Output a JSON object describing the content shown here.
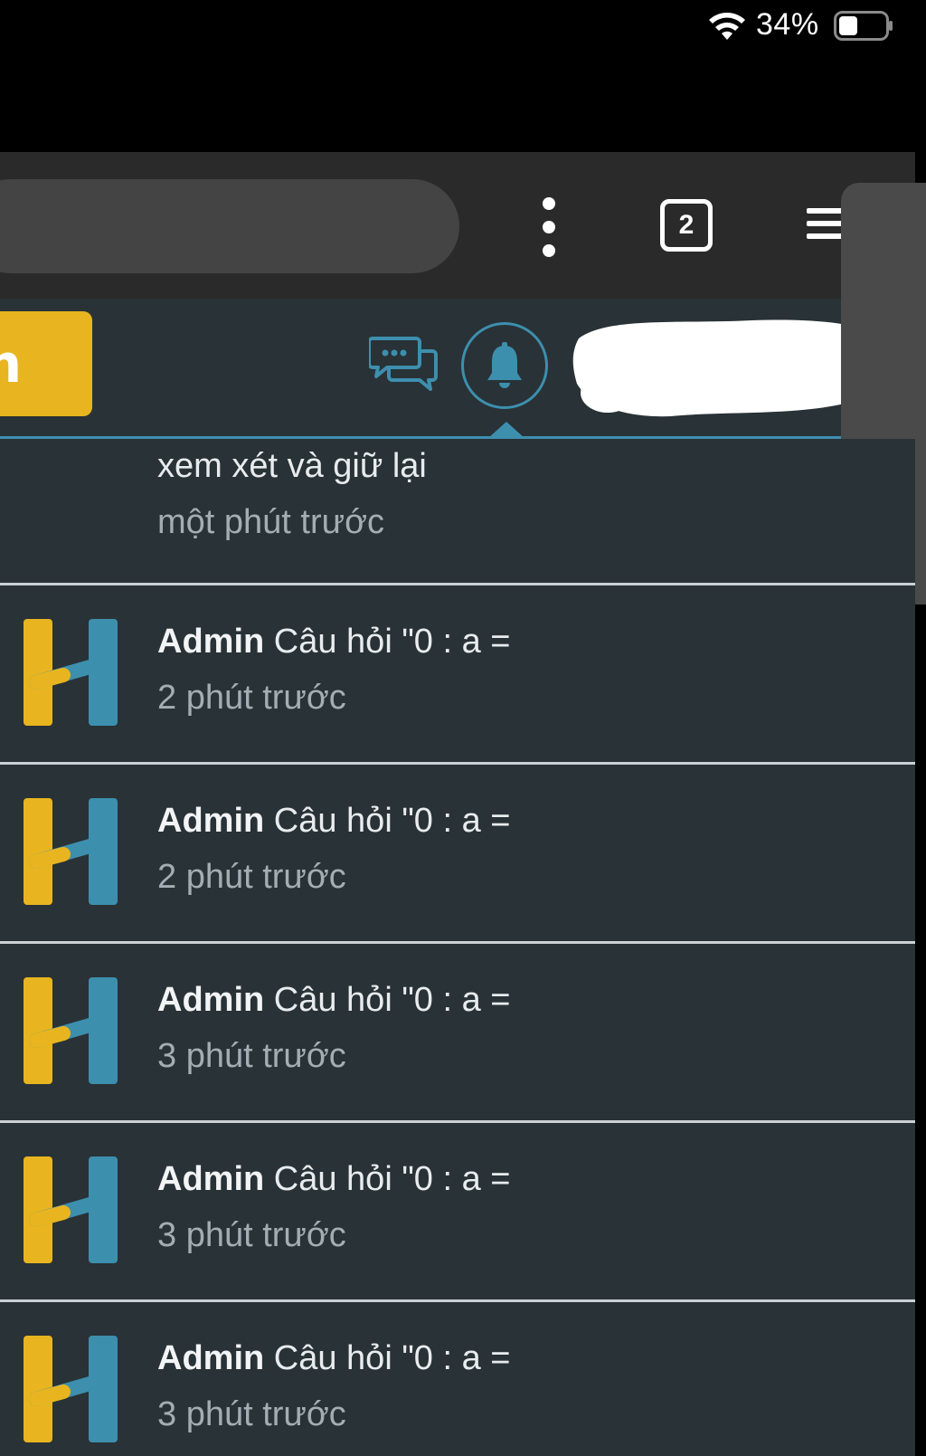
{
  "status_bar": {
    "battery_percent": "34%"
  },
  "browser": {
    "tab_count": "2"
  },
  "header": {
    "yellow_button_label": "n"
  },
  "notifications": {
    "top_item": {
      "text": "xem xét và giữ lại",
      "time": "một phút trước"
    },
    "items": [
      {
        "author": "Admin",
        "text": "Câu hỏi \"0 : a =",
        "time": "2 phút trước"
      },
      {
        "author": "Admin",
        "text": "Câu hỏi \"0 : a =",
        "time": "2 phút trước"
      },
      {
        "author": "Admin",
        "text": "Câu hỏi \"0 : a =",
        "time": "3 phút trước"
      },
      {
        "author": "Admin",
        "text": "Câu hỏi \"0 : a =",
        "time": "3 phút trước"
      },
      {
        "author": "Admin",
        "text": "Câu hỏi \"0 : a =",
        "time": "3 phút trước"
      }
    ]
  },
  "colors": {
    "accent_blue": "#3d8fae",
    "accent_yellow": "#e8b520",
    "panel_bg": "#293236"
  },
  "icons": {
    "wifi": "wifi-icon",
    "battery": "battery-icon",
    "more": "more-vertical-icon",
    "tabs": "tabs-icon",
    "menu": "hamburger-menu-icon",
    "chat": "chat-bubbles-icon",
    "bell": "bell-icon",
    "logo": "h-logo-icon"
  }
}
